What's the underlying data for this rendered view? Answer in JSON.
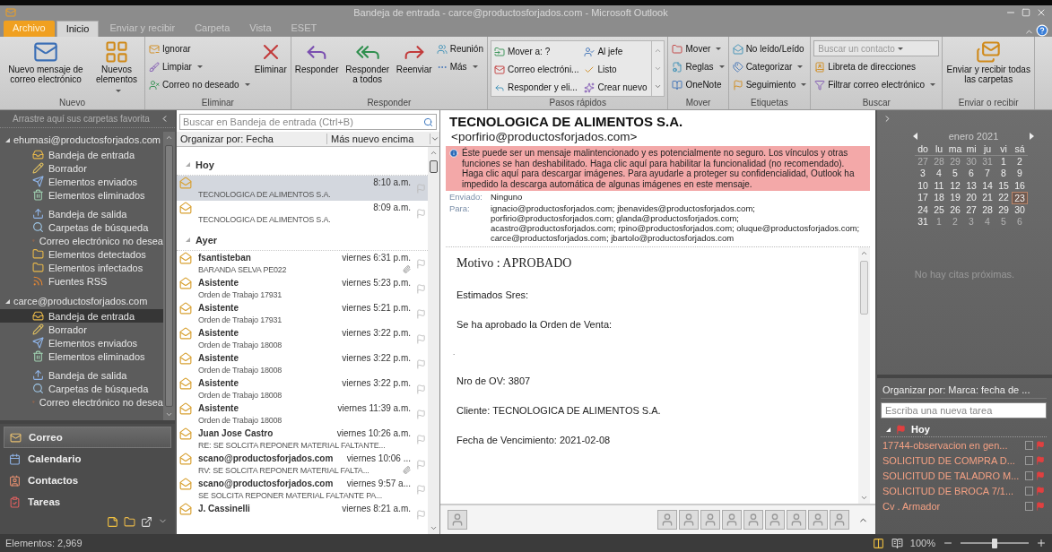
{
  "window": {
    "title": "Bandeja de entrada - carce@productosforjados.com - Microsoft Outlook"
  },
  "tabs": [
    {
      "label": "Archivo",
      "kind": "file",
      "selected": false
    },
    {
      "label": "Inicio",
      "kind": "tab",
      "selected": true
    },
    {
      "label": "Enviar y recibir",
      "kind": "tab",
      "selected": false
    },
    {
      "label": "Carpeta",
      "kind": "tab",
      "selected": false
    },
    {
      "label": "Vista",
      "kind": "tab",
      "selected": false
    },
    {
      "label": "ESET",
      "kind": "tab",
      "selected": false
    }
  ],
  "ribbon": [
    {
      "label": "Nuevo",
      "items": [
        {
          "label": "Nuevo mensaje de correo electrónico",
          "kind": "large",
          "dropdown": false
        },
        {
          "label": "Nuevos elementos",
          "kind": "large",
          "dropdown": true
        }
      ]
    },
    {
      "label": "Eliminar",
      "items": [
        {
          "label": "Ignorar",
          "kind": "small",
          "dropdown": false
        },
        {
          "label": "Limpiar",
          "kind": "small",
          "dropdown": true
        },
        {
          "label": "Correo no deseado",
          "kind": "small",
          "dropdown": true
        },
        {
          "label": "Eliminar",
          "kind": "large",
          "dropdown": false
        }
      ]
    },
    {
      "label": "Responder",
      "items": [
        {
          "label": "Responder",
          "kind": "large",
          "dropdown": false
        },
        {
          "label": "Responder a todos",
          "kind": "large",
          "dropdown": false
        },
        {
          "label": "Reenviar",
          "kind": "large",
          "dropdown": false
        },
        {
          "label": "Reunión",
          "kind": "small",
          "dropdown": false
        },
        {
          "label": "Más",
          "kind": "small",
          "dropdown": true
        }
      ]
    },
    {
      "label": "Pasos rápidos",
      "gallery": true,
      "items": [
        {
          "label": "Mover a: ?",
          "kind": "small",
          "dropdown": false
        },
        {
          "label": "Correo electróni...",
          "kind": "small",
          "dropdown": false
        },
        {
          "label": "Responder y eli...",
          "kind": "small",
          "dropdown": false
        },
        {
          "label": "Al jefe",
          "kind": "small",
          "dropdown": false
        },
        {
          "label": "Listo",
          "kind": "small",
          "dropdown": false
        },
        {
          "label": "Crear nuevo",
          "kind": "small",
          "dropdown": false
        }
      ]
    },
    {
      "label": "Mover",
      "items": [
        {
          "label": "Mover",
          "kind": "small",
          "dropdown": true
        },
        {
          "label": "Reglas",
          "kind": "small",
          "dropdown": true
        },
        {
          "label": "OneNote",
          "kind": "small",
          "dropdown": false
        }
      ]
    },
    {
      "label": "Etiquetas",
      "items": [
        {
          "label": "No leído/Leído",
          "kind": "small",
          "dropdown": false
        },
        {
          "label": "Categorizar",
          "kind": "small",
          "dropdown": true
        },
        {
          "label": "Seguimiento",
          "kind": "small",
          "dropdown": true
        }
      ]
    },
    {
      "label": "Buscar",
      "items": [
        {
          "placeholder": "Buscar un contacto",
          "kind": "field",
          "dropdown": true
        },
        {
          "label": "Libreta de direcciones",
          "kind": "small",
          "dropdown": false
        },
        {
          "label": "Filtrar correo electrónico",
          "kind": "small",
          "dropdown": true
        }
      ]
    },
    {
      "label": "Enviar o recibir",
      "items": [
        {
          "label": "Enviar y recibir todas las carpetas",
          "kind": "large",
          "dropdown": false
        }
      ]
    }
  ],
  "navigation": {
    "favorites_hint": "Arrastre aquí sus carpetas favorita",
    "accounts": [
      {
        "name": "ehumasi@productosforjados.com",
        "expanded": true,
        "folders": [
          {
            "label": "Bandeja de entrada",
            "kind": "inbox",
            "selected": false
          },
          {
            "label": "Borrador",
            "kind": "drafts",
            "selected": false
          },
          {
            "label": "Elementos enviados",
            "kind": "sent",
            "selected": false
          },
          {
            "label": "Elementos eliminados",
            "kind": "deleted",
            "selected": false
          },
          {
            "label": "Bandeja de salida",
            "kind": "outbox",
            "selected": false
          },
          {
            "label": "Carpetas de búsqueda",
            "kind": "search",
            "selected": false
          },
          {
            "label": "Correo electrónico no desea",
            "kind": "junk",
            "selected": false
          },
          {
            "label": "Elementos detectados",
            "kind": "folder",
            "selected": false
          },
          {
            "label": "Elementos infectados",
            "kind": "folder",
            "selected": false
          },
          {
            "label": "Fuentes RSS",
            "kind": "rss",
            "selected": false
          }
        ]
      },
      {
        "name": "carce@productosforjados.com",
        "expanded": true,
        "folders": [
          {
            "label": "Bandeja de entrada",
            "kind": "inbox",
            "selected": true
          },
          {
            "label": "Borrador",
            "kind": "drafts",
            "selected": false
          },
          {
            "label": "Elementos enviados",
            "kind": "sent",
            "selected": false
          },
          {
            "label": "Elementos eliminados",
            "kind": "deleted",
            "selected": false
          },
          {
            "label": "Bandeja de salida",
            "kind": "outbox",
            "selected": false
          },
          {
            "label": "Carpetas de búsqueda",
            "kind": "search",
            "selected": false
          },
          {
            "label": "Correo electrónico no desea",
            "kind": "junk",
            "selected": false
          }
        ]
      }
    ],
    "modules": [
      {
        "label": "Correo",
        "kind": "mail",
        "selected": true
      },
      {
        "label": "Calendario",
        "kind": "calendar",
        "selected": false
      },
      {
        "label": "Contactos",
        "kind": "contacts",
        "selected": false
      },
      {
        "label": "Tareas",
        "kind": "tasks",
        "selected": false
      }
    ]
  },
  "message_list": {
    "search_placeholder": "Buscar en Bandeja de entrada (Ctrl+B)",
    "arrange_by": "Organizar por: Fecha",
    "order": "Más nuevo encima",
    "groups": [
      {
        "label": "Hoy",
        "expanded": true,
        "messages": [
          {
            "time": "8:10 a.m.",
            "subject": "TECNOLOGICA DE ALIMENTOS S.A.",
            "selected": true,
            "attachment": false
          },
          {
            "time": "8:09 a.m.",
            "subject": "TECNOLOGICA DE ALIMENTOS S.A.",
            "selected": false,
            "attachment": false
          }
        ]
      },
      {
        "label": "Ayer",
        "expanded": true,
        "messages": [
          {
            "sender": "fsantisteban",
            "time": "viernes 6:31 p.m.",
            "subject": "BARANDA SELVA PE022",
            "selected": false,
            "attachment": true
          },
          {
            "sender": "Asistente",
            "time": "viernes 5:23 p.m.",
            "subject": "Orden de Trabajo 17931",
            "selected": false,
            "attachment": false
          },
          {
            "sender": "Asistente",
            "time": "viernes 5:21 p.m.",
            "subject": "Orden de Trabajo 17931",
            "selected": false,
            "attachment": false
          },
          {
            "sender": "Asistente",
            "time": "viernes 3:22 p.m.",
            "subject": "Orden de Trabajo 18008",
            "selected": false,
            "attachment": false
          },
          {
            "sender": "Asistente",
            "time": "viernes 3:22 p.m.",
            "subject": "Orden de Trabajo 18008",
            "selected": false,
            "attachment": false
          },
          {
            "sender": "Asistente",
            "time": "viernes 3:22 p.m.",
            "subject": "Orden de Trabajo 18008",
            "selected": false,
            "attachment": false
          },
          {
            "sender": "Asistente",
            "time": "viernes 11:39 a.m.",
            "subject": "Orden de Trabajo 18008",
            "selected": false,
            "attachment": false
          },
          {
            "sender": "Juan Jose Castro",
            "time": "viernes 10:26 a.m.",
            "subject": "RE: SE SOLCITA REPONER MATERIAL FALTANTE...",
            "selected": false,
            "attachment": false
          },
          {
            "sender": "scano@productosforjados.com",
            "time": "viernes 10:06 ...",
            "subject": "RV: SE SOLCITA REPONER MATERIAL FALTA...",
            "selected": false,
            "attachment": true
          },
          {
            "sender": "scano@productosforjados.com",
            "time": "viernes 9:57 a...",
            "subject": "SE SOLCITA REPONER MATERIAL FALTANTE PA...",
            "selected": false,
            "attachment": false
          },
          {
            "sender": "J. Cassinelli",
            "time": "viernes 8:21 a.m.",
            "selected": false,
            "attachment": false
          }
        ]
      }
    ]
  },
  "reading_pane": {
    "from_name": "TECNOLOGICA DE ALIMENTOS S.A.",
    "from_address": "<porfirio@productosforjados.com>",
    "infobar": "Éste puede ser  un mensaje malintencionado y es potencialmente no seguro. Los vínculos y otras funciones se han deshabilitado. Haga clic aquí para habilitar la funcionalidad (no recomendado). Haga clic aquí para descargar imágenes. Para ayudarle a proteger su confidencialidad, Outlook ha impedido la descarga automática de algunas imágenes en este mensaje.",
    "fields": [
      {
        "label": "Enviado:",
        "value": "Ninguno"
      },
      {
        "label": "Para:",
        "value": "ignacio@productosforjados.com; jbenavides@productosforjados.com; porfirio@productosforjados.com; glanda@productosforjados.com; acastro@productosforjados.com; rpino@productosforjados.com; oluque@productosforjados.com; carce@productosforjados.com; jbartolo@productosforjados.com"
      }
    ],
    "body": [
      {
        "text": "Motivo : APROBADO",
        "kind": "heading"
      },
      {
        "text": "Estimados Sres:",
        "kind": "paragraph"
      },
      {
        "text": "Se ha aprobado la Orden de Venta:",
        "kind": "paragraph"
      },
      {
        "text": ".",
        "kind": "dot"
      },
      {
        "text": "Nro de OV: 3807",
        "kind": "paragraph"
      },
      {
        "text": "Cliente: TECNOLOGICA DE ALIMENTOS S.A.",
        "kind": "paragraph"
      },
      {
        "text": "Fecha de Vencimiento: 2021-02-08",
        "kind": "paragraph"
      }
    ]
  },
  "todo_bar": {
    "calendar": {
      "month": "enero 2021",
      "weekdays": [
        "do",
        "lu",
        "ma",
        "mi",
        "ju",
        "vi",
        "sá"
      ],
      "weeks": [
        [
          {
            "day": "27",
            "muted": true,
            "selected": false
          },
          {
            "day": "28",
            "muted": true,
            "selected": false
          },
          {
            "day": "29",
            "muted": true,
            "selected": false
          },
          {
            "day": "30",
            "muted": true,
            "selected": false
          },
          {
            "day": "31",
            "muted": true,
            "selected": false
          },
          {
            "day": "1",
            "muted": false,
            "selected": false
          },
          {
            "day": "2",
            "muted": false,
            "selected": false
          }
        ],
        [
          {
            "day": "3",
            "muted": false,
            "selected": false
          },
          {
            "day": "4",
            "muted": false,
            "selected": false
          },
          {
            "day": "5",
            "muted": false,
            "selected": false
          },
          {
            "day": "6",
            "muted": false,
            "selected": false
          },
          {
            "day": "7",
            "muted": false,
            "selected": false
          },
          {
            "day": "8",
            "muted": false,
            "selected": false
          },
          {
            "day": "9",
            "muted": false,
            "selected": false
          }
        ],
        [
          {
            "day": "10",
            "muted": false,
            "selected": false
          },
          {
            "day": "11",
            "muted": false,
            "selected": false
          },
          {
            "day": "12",
            "muted": false,
            "selected": false
          },
          {
            "day": "13",
            "muted": false,
            "selected": false
          },
          {
            "day": "14",
            "muted": false,
            "selected": false
          },
          {
            "day": "15",
            "muted": false,
            "selected": false
          },
          {
            "day": "16",
            "muted": false,
            "selected": false
          }
        ],
        [
          {
            "day": "17",
            "muted": false,
            "selected": false
          },
          {
            "day": "18",
            "muted": false,
            "selected": false
          },
          {
            "day": "19",
            "muted": false,
            "selected": false
          },
          {
            "day": "20",
            "muted": false,
            "selected": false
          },
          {
            "day": "21",
            "muted": false,
            "selected": false
          },
          {
            "day": "22",
            "muted": false,
            "selected": false
          },
          {
            "day": "23",
            "muted": false,
            "selected": true
          }
        ],
        [
          {
            "day": "24",
            "muted": false,
            "selected": false
          },
          {
            "day": "25",
            "muted": false,
            "selected": false
          },
          {
            "day": "26",
            "muted": false,
            "selected": false
          },
          {
            "day": "27",
            "muted": false,
            "selected": false
          },
          {
            "day": "28",
            "muted": false,
            "selected": false
          },
          {
            "day": "29",
            "muted": false,
            "selected": false
          },
          {
            "day": "30",
            "muted": false,
            "selected": false
          }
        ],
        [
          {
            "day": "31",
            "muted": false,
            "selected": false
          },
          {
            "day": "1",
            "muted": true,
            "selected": false
          },
          {
            "day": "2",
            "muted": true,
            "selected": false
          },
          {
            "day": "3",
            "muted": true,
            "selected": false
          },
          {
            "day": "4",
            "muted": true,
            "selected": false
          },
          {
            "day": "5",
            "muted": true,
            "selected": false
          },
          {
            "day": "6",
            "muted": true,
            "selected": false
          }
        ]
      ]
    },
    "appointments_empty": "No hay citas próximas.",
    "tasks": {
      "arrange_by": "Organizar por: Marca: fecha de ...",
      "new_task_placeholder": "Escriba una nueva tarea",
      "group": "Hoy",
      "items": [
        {
          "label": "17744-observacion en gen...",
          "checked": false
        },
        {
          "label": "SOLICITUD DE COMPRA D...",
          "checked": false
        },
        {
          "label": "SOLICITUD DE TALADRO M...",
          "checked": false
        },
        {
          "label": "SOLICITUD DE BROCA 7/1...",
          "checked": false
        },
        {
          "label": "Cv . Armador",
          "checked": false
        }
      ]
    }
  },
  "status_bar": {
    "items_count": "Elementos: 2,969",
    "zoom": "100%",
    "zoom_level": {
      "level": 0.5
    }
  }
}
